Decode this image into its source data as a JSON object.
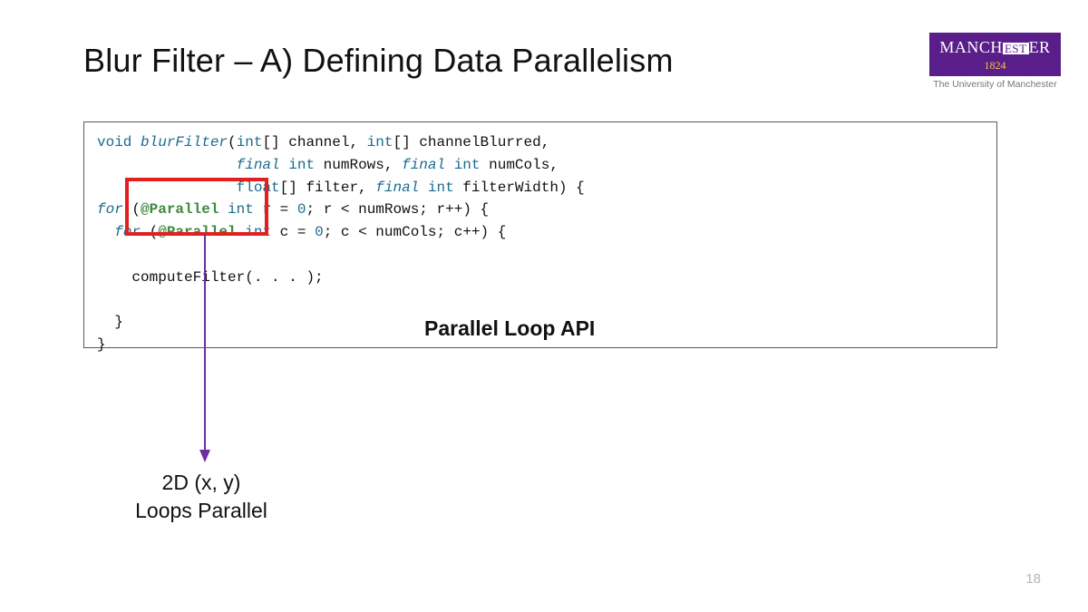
{
  "title": "Blur Filter – A) Defining Data Parallelism",
  "logo": {
    "line1_left": "MANCH",
    "line1_mid": "EST",
    "line1_right": "ER",
    "year": "1824",
    "subtitle": "The University of Manchester"
  },
  "code": {
    "l1_void": "void",
    "l1_fn": "blurFilter",
    "l1_rest1": "(",
    "l1_int1": "int",
    "l1_rest2": "[] channel, ",
    "l1_int2": "int",
    "l1_rest3": "[] channelBlurred,",
    "l2_pad": "                ",
    "l2_final1": "final",
    "l2_sp1": " ",
    "l2_int1": "int",
    "l2_rest1": " numRows, ",
    "l2_final2": "final",
    "l2_sp2": " ",
    "l2_int2": "int",
    "l2_rest2": " numCols,",
    "l3_pad": "                ",
    "l3_float": "float",
    "l3_rest1": "[] filter, ",
    "l3_final": "final",
    "l3_sp": " ",
    "l3_int": "int",
    "l3_rest2": " filterWidth) {",
    "l4_for": "for",
    "l4_rest1": " (",
    "l4_ann": "@Parallel",
    "l4_sp": " ",
    "l4_int": "int",
    "l4_rest2": " r = ",
    "l4_zero": "0",
    "l4_rest3": "; r < numRows; r++) {",
    "l5_pad": "  ",
    "l5_for": "for",
    "l5_rest1": " (",
    "l5_ann": "@Parallel",
    "l5_sp": " ",
    "l5_int": "int",
    "l5_rest2": " c = ",
    "l5_zero": "0",
    "l5_rest3": "; c < numCols; c++) {",
    "l6": "",
    "l7": "    computeFilter(. . . );",
    "l8": "",
    "l9": "  }",
    "l10": "}"
  },
  "api_label": "Parallel Loop API",
  "annotation": {
    "line1": "2D (x, y)",
    "line2": "Loops Parallel"
  },
  "page_number": "18"
}
